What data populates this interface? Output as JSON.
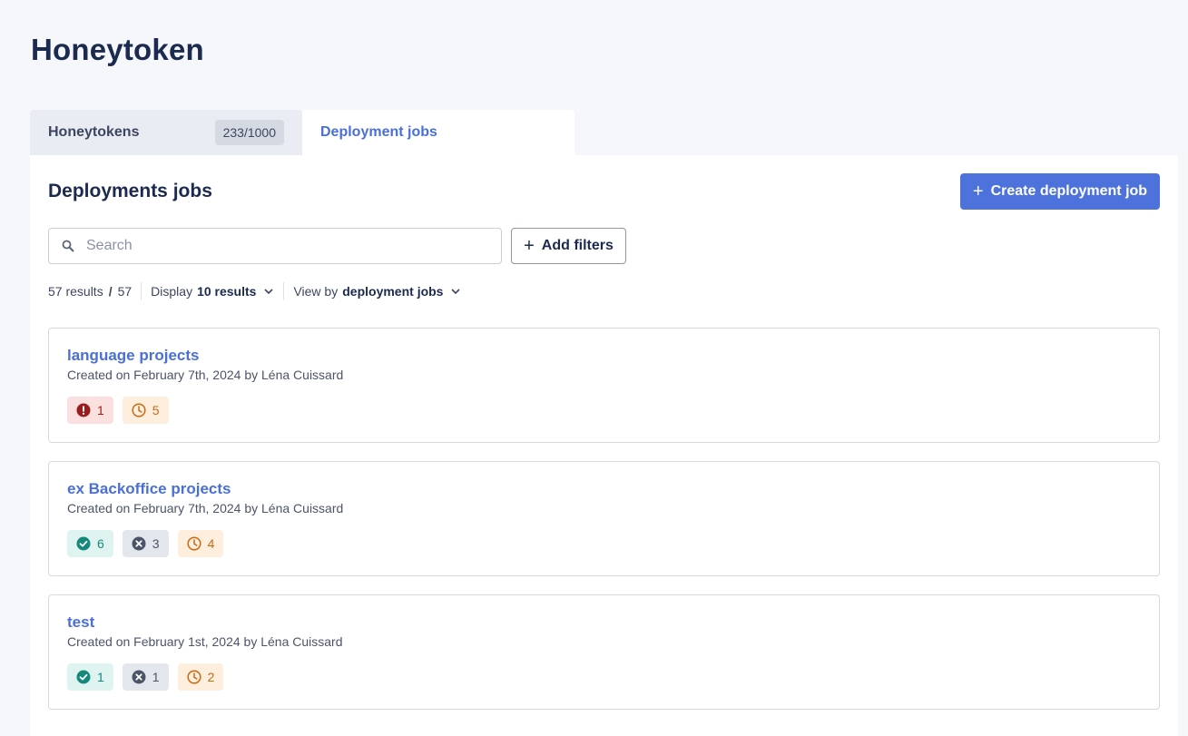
{
  "page": {
    "title": "Honeytoken"
  },
  "tabs": [
    {
      "label": "Honeytokens",
      "count": "233/1000"
    },
    {
      "label": "Deployment jobs"
    }
  ],
  "panel": {
    "title": "Deployments jobs",
    "create_label": "Create deployment job",
    "search_placeholder": "Search",
    "filter_label": "Add filters"
  },
  "results": {
    "count": "57 results",
    "slash": "/",
    "total": "57",
    "display_label": "Display",
    "display_value": "10 results",
    "viewby_label": "View by",
    "viewby_value": "deployment jobs"
  },
  "jobs": [
    {
      "title": "language projects",
      "subtitle": "Created on February 7th, 2024 by Léna Cuissard",
      "badges": [
        {
          "type": "error",
          "icon": "error-icon",
          "value": "1"
        },
        {
          "type": "pending",
          "icon": "clock-icon",
          "value": "5"
        }
      ]
    },
    {
      "title": "ex Backoffice projects",
      "subtitle": "Created on February 7th, 2024 by Léna Cuissard",
      "badges": [
        {
          "type": "success",
          "icon": "check-circle-icon",
          "value": "6"
        },
        {
          "type": "failed",
          "icon": "x-circle-icon",
          "value": "3"
        },
        {
          "type": "pending",
          "icon": "clock-icon",
          "value": "4"
        }
      ]
    },
    {
      "title": "test",
      "subtitle": "Created on February 1st, 2024 by Léna Cuissard",
      "badges": [
        {
          "type": "success",
          "icon": "check-circle-icon",
          "value": "1"
        },
        {
          "type": "failed",
          "icon": "x-circle-icon",
          "value": "1"
        },
        {
          "type": "pending",
          "icon": "clock-icon",
          "value": "2"
        }
      ]
    }
  ],
  "colors": {
    "accent": "#4e72dc",
    "link": "#4a6fd6",
    "error": "#9b1c1c",
    "pending": "#c96a12",
    "success": "#14897a",
    "failed": "#4b5468"
  }
}
